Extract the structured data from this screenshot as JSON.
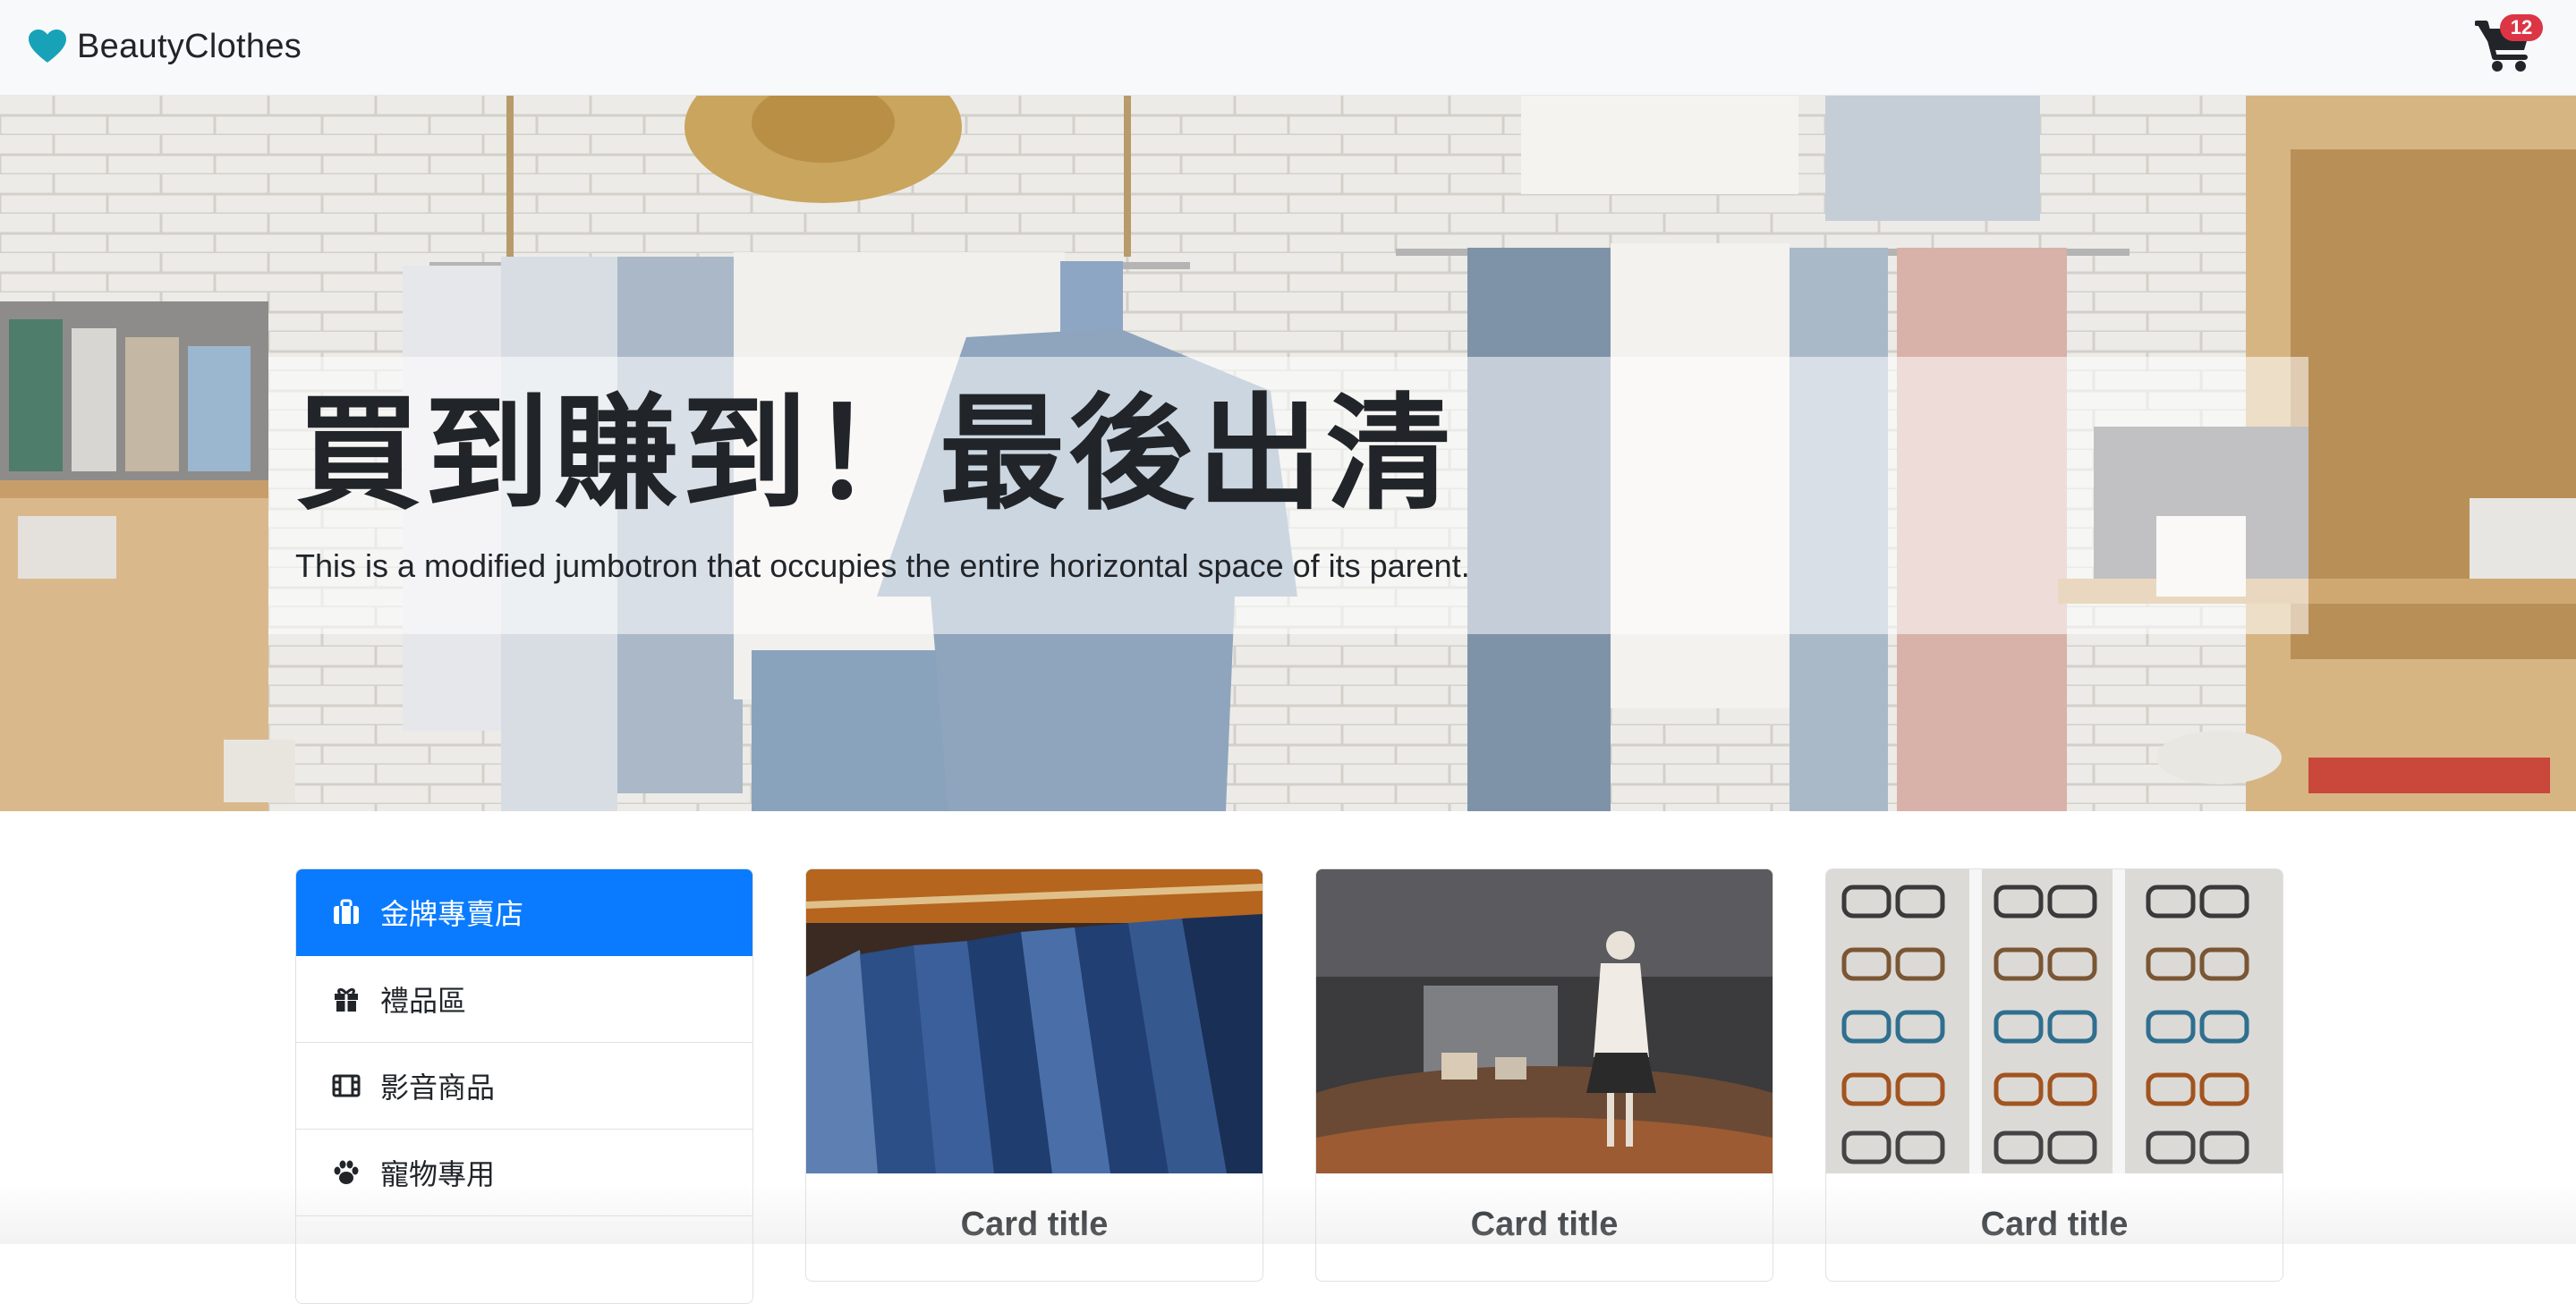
{
  "navbar": {
    "brand": "BeautyClothes",
    "brand_icon": "heart-icon",
    "brand_icon_color": "#17a2b8",
    "cart_icon": "cart-icon",
    "cart_count": "12",
    "cart_badge_color": "#dc3545"
  },
  "hero": {
    "title": "買到賺到！最後出清",
    "subtitle": "This is a modified jumbotron that occupies the entire horizontal space of its parent."
  },
  "sidebar": {
    "active_color": "#0a7bff",
    "items": [
      {
        "label": "金牌專賣店",
        "icon": "briefcase-icon",
        "active": true
      },
      {
        "label": "禮品區",
        "icon": "gift-icon",
        "active": false
      },
      {
        "label": "影音商品",
        "icon": "film-icon",
        "active": false
      },
      {
        "label": "寵物專用",
        "icon": "paw-icon",
        "active": false
      }
    ]
  },
  "cards": [
    {
      "title": "Card title",
      "image": "clothes-rack-photo"
    },
    {
      "title": "Card title",
      "image": "store-window-mannequin-photo"
    },
    {
      "title": "Card title",
      "image": "eyeglasses-display-photo"
    }
  ]
}
